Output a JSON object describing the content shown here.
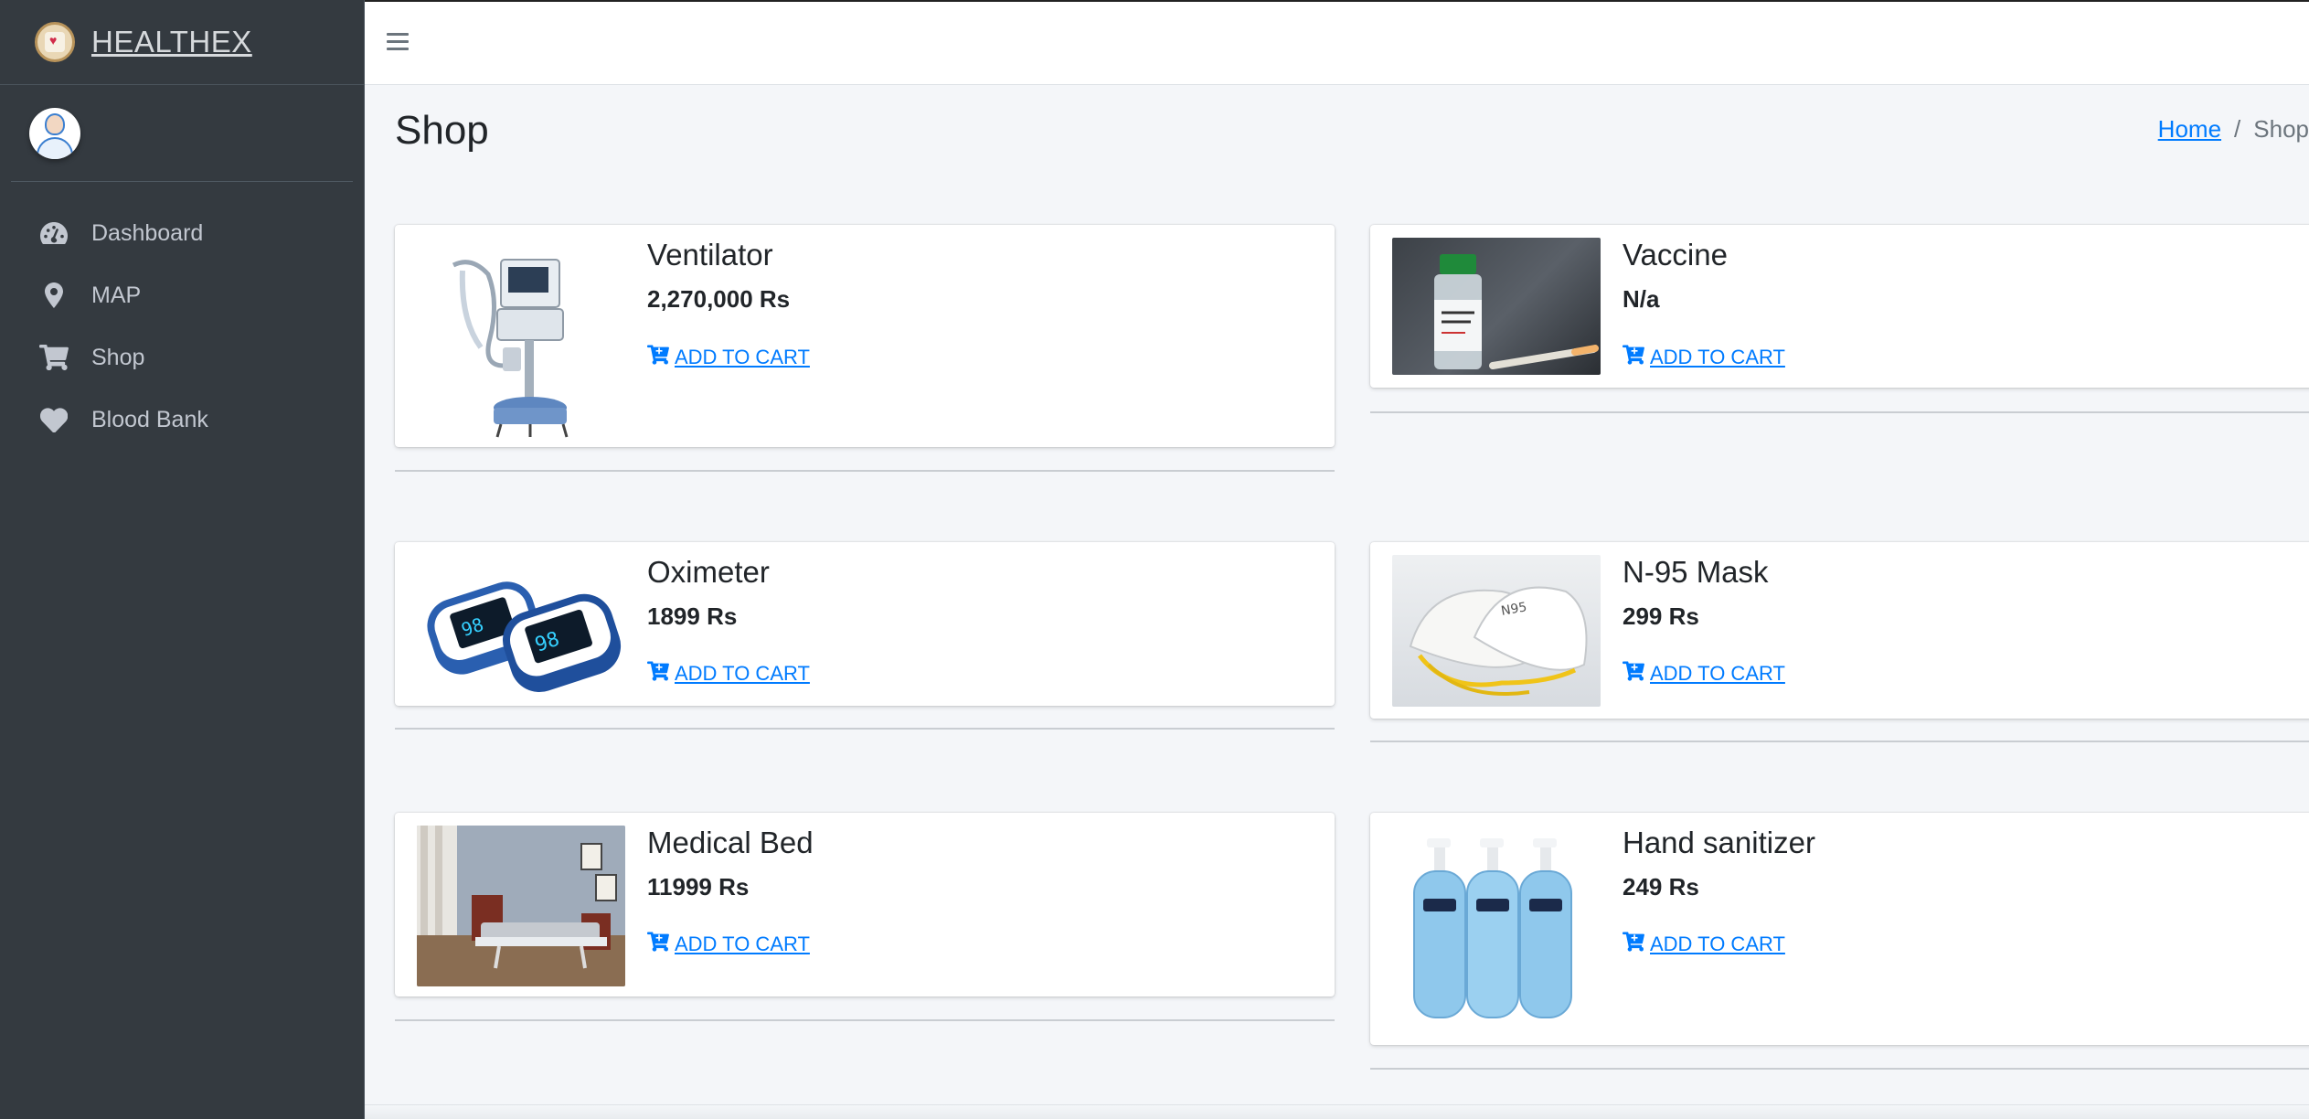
{
  "brand": {
    "name": "HEALTHEX"
  },
  "sidebar": {
    "items": [
      {
        "label": "Dashboard",
        "icon": "tachometer-icon"
      },
      {
        "label": "MAP",
        "icon": "map-marker-icon"
      },
      {
        "label": "Shop",
        "icon": "shopping-cart-icon"
      },
      {
        "label": "Blood Bank",
        "icon": "heart-icon"
      }
    ]
  },
  "header": {
    "title": "Shop",
    "breadcrumb": {
      "home": "Home",
      "separator": "/",
      "current": "Shop"
    }
  },
  "products": [
    {
      "name": "Ventilator",
      "price": "2,270,000 Rs",
      "action": " ADD TO CART"
    },
    {
      "name": "Vaccine",
      "price": "N/a",
      "action": " ADD TO CART"
    },
    {
      "name": "Oximeter",
      "price": "1899 Rs",
      "action": " ADD TO CART"
    },
    {
      "name": "N-95 Mask",
      "price": "299 Rs",
      "action": " ADD TO CART"
    },
    {
      "name": "Medical Bed",
      "price": "11999 Rs",
      "action": " ADD TO CART"
    },
    {
      "name": "Hand sanitizer",
      "price": "249 Rs",
      "action": " ADD TO CART"
    }
  ],
  "colors": {
    "sidebar_bg": "#343a40",
    "link": "#007bff",
    "content_bg": "#f4f6f9"
  }
}
